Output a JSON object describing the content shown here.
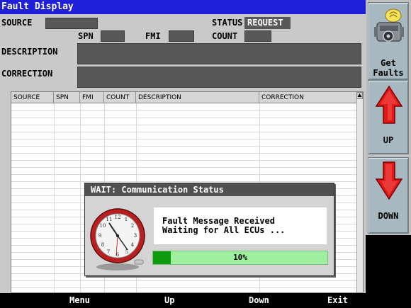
{
  "window": {
    "title": "Fault Display"
  },
  "header": {
    "source_label": "SOURCE",
    "spn_label": "SPN",
    "fmi_label": "FMI",
    "count_label": "COUNT",
    "status_label": "STATUS",
    "status_value": "REQUEST",
    "description_label": "DESCRIPTION",
    "correction_label": "CORRECTION"
  },
  "table": {
    "columns": [
      "SOURCE",
      "SPN",
      "FMI",
      "COUNT",
      "DESCRIPTION",
      "CORRECTION"
    ],
    "rows": [],
    "scroll_up_icon": "triangle-up-icon"
  },
  "sidebar": {
    "get_faults_label": "Get\nFaults",
    "get_faults_icon": "engine-icon",
    "up_label": "UP",
    "up_icon": "arrow-up-icon",
    "down_label": "DOWN",
    "down_icon": "arrow-down-icon"
  },
  "dialog": {
    "title": "WAIT: Communication Status",
    "message_line1": "Fault Message Received",
    "message_line2": "Waiting for All ECUs ...",
    "progress_percent": 10,
    "progress_text": "10%",
    "icon": "clock-icon"
  },
  "footer": {
    "menu_label": "Menu",
    "up_label": "Up",
    "down_label": "Down",
    "exit_label": "Exit"
  },
  "colors": {
    "title_bar": "#2020d8",
    "field_bg": "#585858",
    "arrow_red": "#e01818",
    "progress_fill": "#0d9a0d",
    "progress_track": "#9ef09e"
  }
}
